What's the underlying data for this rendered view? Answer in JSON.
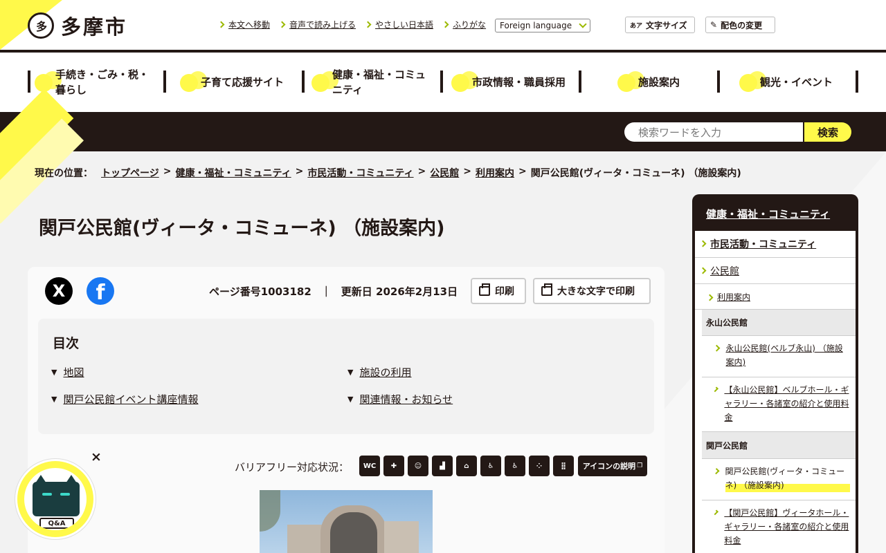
{
  "header": {
    "logo_text": "多摩市",
    "util_links": [
      "本文へ移動",
      "音声で読み上げる",
      "やさしい日本語",
      "ふりがな"
    ],
    "language_select": "Foreign language",
    "font_size_aa": "あア",
    "font_size_label": "文字サイズ",
    "color_change_label": "配色の変更"
  },
  "nav": {
    "items": [
      {
        "label_line1": "手続き・ごみ・税・",
        "label_line2": "暮らし"
      },
      {
        "label_line1": "子育て応援サイト",
        "label_line2": ""
      },
      {
        "label_line1": "健康・福祉・コミュ",
        "label_line2": "ニティ"
      },
      {
        "label_line1": "市政情報・職員採用",
        "label_line2": ""
      },
      {
        "label_line1": "施設案内",
        "label_line2": ""
      },
      {
        "label_line1": "観光・イベント",
        "label_line2": ""
      }
    ]
  },
  "search": {
    "placeholder": "検索ワードを入力",
    "button_label": "検索"
  },
  "breadcrumb": {
    "here_label": "現在の位置：",
    "items": [
      "トップページ",
      "健康・福祉・コミュニティ",
      "市民活動・コミュニティ",
      "公民館",
      "利用案内"
    ],
    "current": "関戸公民館(ヴィータ・コミューネ) （施設案内)",
    "separator": ">"
  },
  "page": {
    "title": "関戸公民館(ヴィータ・コミューネ) （施設案内)",
    "sns_x": "X",
    "sns_fb": "f",
    "page_number": "ページ番号1003182",
    "meta_sep": "｜",
    "updated": "更新日 2026年2月13日",
    "print_label": "印刷",
    "print_large_label": "大きな文字で印刷"
  },
  "toc": {
    "title": "目次",
    "items": [
      "地図",
      "施設の利用",
      "関戸公民館イベント講座情報",
      "関連情報・お知らせ"
    ],
    "marker": "▼"
  },
  "barrier_free": {
    "label": "バリアフリー対応状況：",
    "icons": [
      "wc-icon",
      "first-aid-icon",
      "baby-icon",
      "stairs-icon",
      "bed-icon",
      "wheelchair-icon",
      "elevator-icon",
      "braille-icon",
      "tactile-icon"
    ],
    "icon_glyphs": [
      "WC",
      "✚",
      "☺",
      "▟",
      "⌂",
      "♿",
      "♿",
      "⁘",
      "⣿"
    ],
    "explain_label": "アイコンの説明"
  },
  "sidebar": {
    "heading": "健康・福祉・コミュニティ",
    "items": [
      "市民活動・コミュニティ",
      "公民館",
      "利用案内"
    ],
    "group1_title": "永山公民館",
    "group1_items": [
      "永山公民館(ベルブ永山) （施設案内)",
      "【永山公民館】ベルブホール・ギャラリー・各諸室の紹介と使用料金"
    ],
    "group2_title": "関戸公民館",
    "group2_items": [
      "関戸公民館(ヴィータ・コミューネ) （施設案内)",
      "【関戸公民館】ヴィータホール・ギャラリー・各諸室の紹介と使用料金"
    ]
  },
  "chat": {
    "close": "×",
    "qa_label": "Q&A"
  },
  "colors": {
    "accent": "#fff94a",
    "dark": "#231815",
    "chevron": "#9cb900"
  }
}
